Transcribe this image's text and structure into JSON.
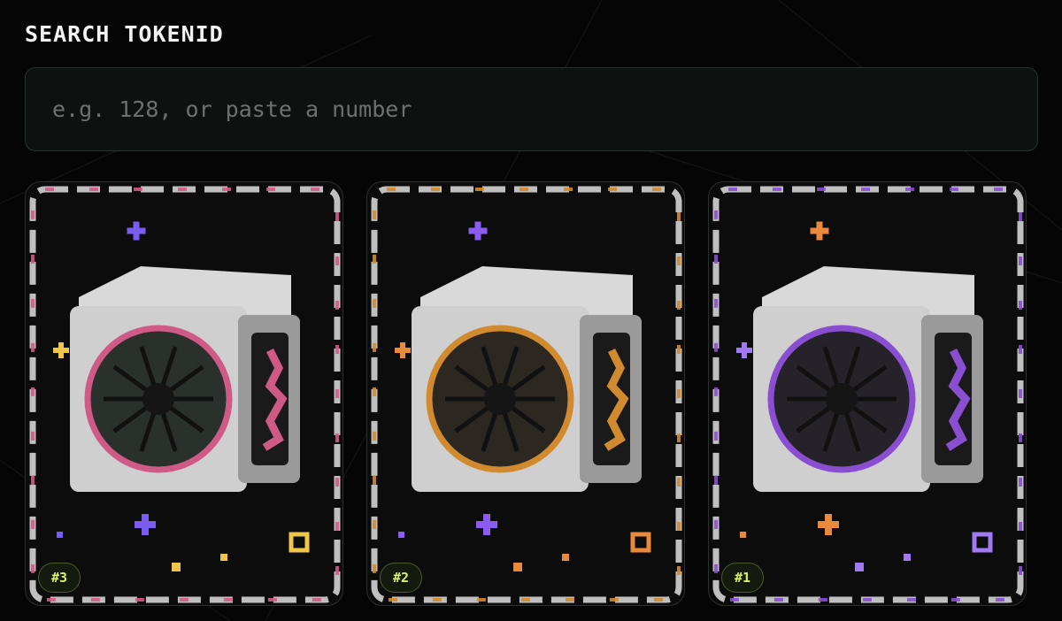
{
  "search": {
    "title": "SEARCH TOKENID",
    "placeholder": "e.g. 128, or paste a number",
    "value": ""
  },
  "cards": [
    {
      "id_label": "#3",
      "accent": "#d05a86",
      "sparkle": "#7a5cf0",
      "sparkle2": "#f0c64a",
      "core": "#2a302c"
    },
    {
      "id_label": "#2",
      "accent": "#d28a2e",
      "sparkle": "#8a5cf0",
      "sparkle2": "#e8893c",
      "core": "#2c2721"
    },
    {
      "id_label": "#1",
      "accent": "#8a4fd0",
      "sparkle": "#e8893c",
      "sparkle2": "#a07af0",
      "core": "#262229"
    }
  ]
}
